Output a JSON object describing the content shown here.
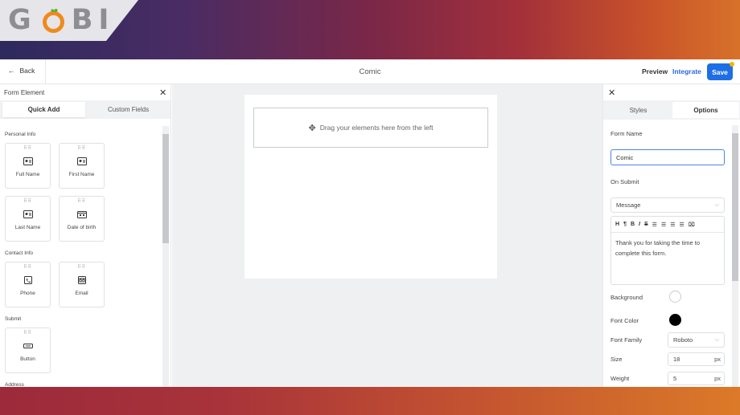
{
  "brand": {
    "logo_text": "GOBI"
  },
  "topbar": {
    "back_label": "Back",
    "form_title": "Comic",
    "preview_label": "Preview",
    "integrate_label": "Integrate",
    "save_label": "Save"
  },
  "left_panel": {
    "title": "Form Element",
    "tabs": [
      "Quick Add",
      "Custom Fields"
    ],
    "sections": [
      {
        "label": "Personal Info",
        "items": [
          "Full Name",
          "First Name",
          "Last Name",
          "Date of birth"
        ]
      },
      {
        "label": "Contact Info",
        "items": [
          "Phone",
          "Email"
        ]
      },
      {
        "label": "Submit",
        "items": [
          "Button"
        ]
      },
      {
        "label": "Address",
        "items": []
      }
    ]
  },
  "canvas": {
    "dropzone_text": "Drag your elements here from the left"
  },
  "right_panel": {
    "tabs": [
      "Styles",
      "Options"
    ],
    "form_name_label": "Form Name",
    "form_name_value": "Comic",
    "on_submit_label": "On Submit",
    "on_submit_value": "Message",
    "toolbar_icons": [
      "heading-icon",
      "paragraph-icon",
      "bold-icon",
      "italic-icon",
      "strikethrough-icon",
      "align-left-icon",
      "align-center-icon",
      "align-right-icon",
      "align-justify-icon",
      "attachment-icon"
    ],
    "message_text": "Thank you for taking the time to complete this form.",
    "background_label": "Background",
    "font_color_label": "Font Color",
    "font_family_label": "Font Family",
    "font_family_value": "Roboto",
    "size_label": "Size",
    "size_value": "18",
    "size_unit": "px",
    "weight_label": "Weight",
    "weight_value": "5",
    "weight_unit": "px"
  },
  "colors": {
    "accent": "#1e6fe5",
    "integrate": "#2a67e0",
    "background_swatch": "#ffffff",
    "font_color_swatch": "#000000",
    "notification_dot": "#f4b400"
  }
}
